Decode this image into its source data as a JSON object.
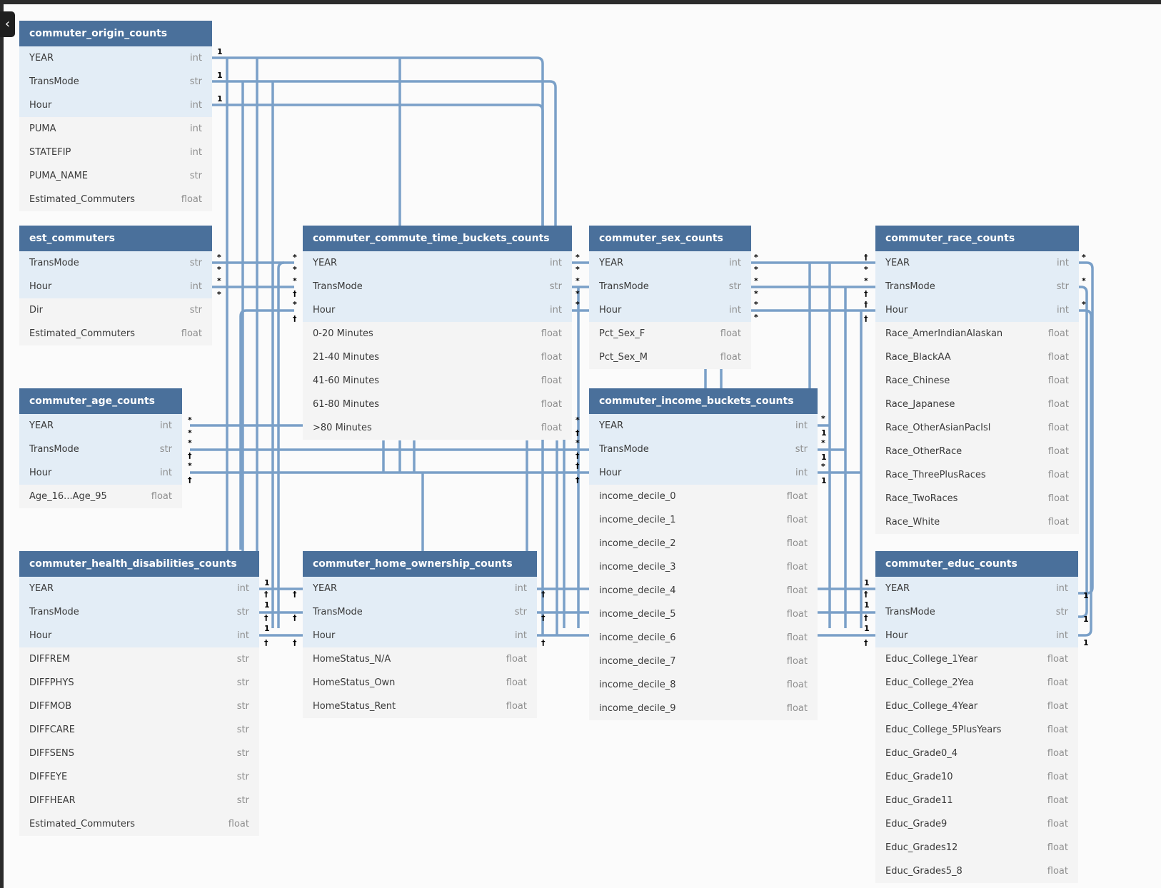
{
  "colors": {
    "header": "#4a709b",
    "link": "#7aa0c8",
    "key_row": "#e3edf6"
  },
  "ui": {
    "collapse_icon": "‹"
  },
  "tables": [
    {
      "name": "commuter_origin_counts",
      "columns": [
        {
          "name": "YEAR",
          "type": "int",
          "key": true
        },
        {
          "name": "TransMode",
          "type": "str",
          "key": true
        },
        {
          "name": "Hour",
          "type": "int",
          "key": true
        },
        {
          "name": "PUMA",
          "type": "int",
          "key": false
        },
        {
          "name": "STATEFIP",
          "type": "int",
          "key": false
        },
        {
          "name": "PUMA_NAME",
          "type": "str",
          "key": false
        },
        {
          "name": "Estimated_Commuters",
          "type": "float",
          "key": false
        }
      ]
    },
    {
      "name": "est_commuters",
      "columns": [
        {
          "name": "TransMode",
          "type": "str",
          "key": true
        },
        {
          "name": "Hour",
          "type": "int",
          "key": true
        },
        {
          "name": "Dir",
          "type": "str",
          "key": false
        },
        {
          "name": "Estimated_Commuters",
          "type": "float",
          "key": false
        }
      ]
    },
    {
      "name": "commuter_age_counts",
      "columns": [
        {
          "name": "YEAR",
          "type": "int",
          "key": true
        },
        {
          "name": "TransMode",
          "type": "str",
          "key": true
        },
        {
          "name": "Hour",
          "type": "int",
          "key": true
        },
        {
          "name": "Age_16...Age_95",
          "type": "float",
          "key": false
        }
      ]
    },
    {
      "name": "commuter_health_disabilities_counts",
      "columns": [
        {
          "name": "YEAR",
          "type": "int",
          "key": true
        },
        {
          "name": "TransMode",
          "type": "str",
          "key": true
        },
        {
          "name": "Hour",
          "type": "int",
          "key": true
        },
        {
          "name": "DIFFREM",
          "type": "str",
          "key": false
        },
        {
          "name": "DIFFPHYS",
          "type": "str",
          "key": false
        },
        {
          "name": "DIFFMOB",
          "type": "str",
          "key": false
        },
        {
          "name": "DIFFCARE",
          "type": "str",
          "key": false
        },
        {
          "name": "DIFFSENS",
          "type": "str",
          "key": false
        },
        {
          "name": "DIFFEYE",
          "type": "str",
          "key": false
        },
        {
          "name": "DIFFHEAR",
          "type": "str",
          "key": false
        },
        {
          "name": "Estimated_Commuters",
          "type": "float",
          "key": false
        }
      ]
    },
    {
      "name": "commuter_commute_time_buckets_counts",
      "columns": [
        {
          "name": "YEAR",
          "type": "int",
          "key": true
        },
        {
          "name": "TransMode",
          "type": "str",
          "key": true
        },
        {
          "name": "Hour",
          "type": "int",
          "key": true
        },
        {
          "name": "0-20 Minutes",
          "type": "float",
          "key": false
        },
        {
          "name": "21-40 Minutes",
          "type": "float",
          "key": false
        },
        {
          "name": "41-60 Minutes",
          "type": "float",
          "key": false
        },
        {
          "name": "61-80 Minutes",
          "type": "float",
          "key": false
        },
        {
          "name": ">80 Minutes",
          "type": "float",
          "key": false
        }
      ]
    },
    {
      "name": "commuter_home_ownership_counts",
      "columns": [
        {
          "name": "YEAR",
          "type": "int",
          "key": true
        },
        {
          "name": "TransMode",
          "type": "str",
          "key": true
        },
        {
          "name": "Hour",
          "type": "int",
          "key": true
        },
        {
          "name": "HomeStatus_N/A",
          "type": "float",
          "key": false
        },
        {
          "name": "HomeStatus_Own",
          "type": "float",
          "key": false
        },
        {
          "name": "HomeStatus_Rent",
          "type": "float",
          "key": false
        }
      ]
    },
    {
      "name": "commuter_sex_counts",
      "columns": [
        {
          "name": "YEAR",
          "type": "int",
          "key": true
        },
        {
          "name": "TransMode",
          "type": "str",
          "key": true
        },
        {
          "name": "Hour",
          "type": "int",
          "key": true
        },
        {
          "name": "Pct_Sex_F",
          "type": "float",
          "key": false
        },
        {
          "name": "Pct_Sex_M",
          "type": "float",
          "key": false
        }
      ]
    },
    {
      "name": "commuter_income_buckets_counts",
      "columns": [
        {
          "name": "YEAR",
          "type": "int",
          "key": true
        },
        {
          "name": "TransMode",
          "type": "str",
          "key": true
        },
        {
          "name": "Hour",
          "type": "int",
          "key": true
        },
        {
          "name": "income_decile_0",
          "type": "float",
          "key": false
        },
        {
          "name": "income_decile_1",
          "type": "float",
          "key": false
        },
        {
          "name": "income_decile_2",
          "type": "float",
          "key": false
        },
        {
          "name": "income_decile_3",
          "type": "float",
          "key": false
        },
        {
          "name": "income_decile_4",
          "type": "float",
          "key": false
        },
        {
          "name": "income_decile_5",
          "type": "float",
          "key": false
        },
        {
          "name": "income_decile_6",
          "type": "float",
          "key": false
        },
        {
          "name": "income_decile_7",
          "type": "float",
          "key": false
        },
        {
          "name": "income_decile_8",
          "type": "float",
          "key": false
        },
        {
          "name": "income_decile_9",
          "type": "float",
          "key": false
        }
      ]
    },
    {
      "name": "commuter_race_counts",
      "columns": [
        {
          "name": "YEAR",
          "type": "int",
          "key": true
        },
        {
          "name": "TransMode",
          "type": "str",
          "key": true
        },
        {
          "name": "Hour",
          "type": "int",
          "key": true
        },
        {
          "name": "Race_AmerIndianAlaskan",
          "type": "float",
          "key": false
        },
        {
          "name": "Race_BlackAA",
          "type": "float",
          "key": false
        },
        {
          "name": "Race_Chinese",
          "type": "float",
          "key": false
        },
        {
          "name": "Race_Japanese",
          "type": "float",
          "key": false
        },
        {
          "name": "Race_OtherAsianPacIsl",
          "type": "float",
          "key": false
        },
        {
          "name": "Race_OtherRace",
          "type": "float",
          "key": false
        },
        {
          "name": "Race_ThreePlusRaces",
          "type": "float",
          "key": false
        },
        {
          "name": "Race_TwoRaces",
          "type": "float",
          "key": false
        },
        {
          "name": "Race_White",
          "type": "float",
          "key": false
        }
      ]
    },
    {
      "name": "commuter_educ_counts",
      "columns": [
        {
          "name": "YEAR",
          "type": "int",
          "key": true
        },
        {
          "name": "TransMode",
          "type": "str",
          "key": true
        },
        {
          "name": "Hour",
          "type": "int",
          "key": true
        },
        {
          "name": "Educ_College_1Year",
          "type": "float",
          "key": false
        },
        {
          "name": "Educ_College_2Yea",
          "type": "float",
          "key": false
        },
        {
          "name": "Educ_College_4Year",
          "type": "float",
          "key": false
        },
        {
          "name": "Educ_College_5PlusYears",
          "type": "float",
          "key": false
        },
        {
          "name": "Educ_Grade0_4",
          "type": "float",
          "key": false
        },
        {
          "name": "Educ_Grade10",
          "type": "float",
          "key": false
        },
        {
          "name": "Educ_Grade11",
          "type": "float",
          "key": false
        },
        {
          "name": "Educ_Grade9",
          "type": "float",
          "key": false
        },
        {
          "name": "Educ_Grades12",
          "type": "float",
          "key": false
        },
        {
          "name": "Educ_Grades5_8",
          "type": "float",
          "key": false
        }
      ]
    }
  ],
  "relationships": [
    {
      "from": "commuter_origin_counts",
      "to": "est_commuters",
      "from_card": "1",
      "to_card": "*"
    },
    {
      "from": "commuter_origin_counts",
      "to": "commuter_commute_time_buckets_counts",
      "from_card": "1",
      "to_card": "*"
    },
    {
      "from": "commuter_origin_counts",
      "to": "commuter_sex_counts",
      "from_card": "1",
      "to_card": "*"
    },
    {
      "from": "commuter_age_counts",
      "to": "commuter_commute_time_buckets_counts",
      "from_card": "*",
      "to_card": "1"
    },
    {
      "from": "commuter_age_counts",
      "to": "commuter_income_buckets_counts",
      "from_card": "*",
      "to_card": "1"
    },
    {
      "from": "commuter_health_disabilities_counts",
      "to": "commuter_home_ownership_counts",
      "from_card": "1",
      "to_card": "1"
    },
    {
      "from": "commuter_sex_counts",
      "to": "commuter_race_counts",
      "from_card": "*",
      "to_card": "1"
    },
    {
      "from": "commuter_income_buckets_counts",
      "to": "commuter_educ_counts",
      "from_card": "1",
      "to_card": "1"
    },
    {
      "from": "commuter_race_counts",
      "to": "commuter_educ_counts",
      "from_card": "*",
      "to_card": "1"
    }
  ]
}
